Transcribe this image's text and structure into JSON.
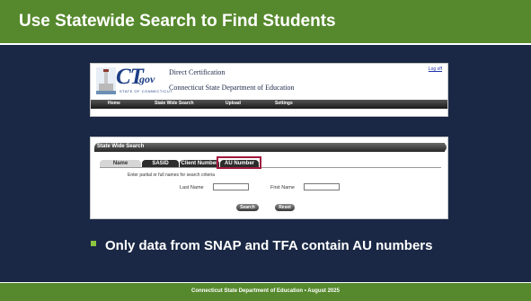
{
  "slide": {
    "title": "Use Statewide Search to Find Students",
    "bullet": "Only data from SNAP and TFA contain AU numbers",
    "footer": "Connecticut State Department of Education • August 2025"
  },
  "app": {
    "logo_ct": "CT",
    "logo_gov": "gov",
    "logo_state": "STATE OF CONNECTICUT",
    "line1": "Direct Certification",
    "line2": "Connecticut State Department of Education",
    "logoff": "Log off",
    "nav": [
      "Home",
      "State Wide Search",
      "Upload",
      "Settings"
    ]
  },
  "search": {
    "panel_title": "State Wide Search",
    "tabs": [
      "Name",
      "SASID",
      "Client Number",
      "AU Number"
    ],
    "selected_tab": "Name",
    "instructions": "Enter partial or full names for search criteria",
    "last_name_label": "Last Name",
    "last_name_value": "",
    "first_name_label": "First Name",
    "first_name_value": "",
    "search_button": "Search",
    "reset_button": "Reset"
  },
  "colors": {
    "background": "#1a2845",
    "accent_green": "#56892d",
    "highlight": "#a0173c"
  }
}
